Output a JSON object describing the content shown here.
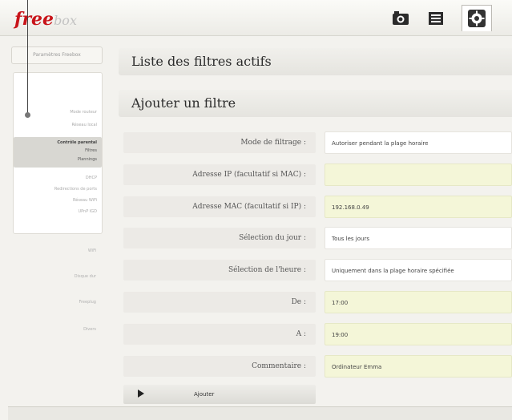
{
  "app": {
    "logo_free": "free",
    "logo_box": "box"
  },
  "topnav": {
    "icons": [
      "camera-icon",
      "film-icon",
      "settings-icon"
    ]
  },
  "sidebar": {
    "top_label": "Paramètres Freebox",
    "items_before": [
      "Mode routeur",
      "Réseau local"
    ],
    "active_group": {
      "title": "Contrôle parental",
      "sub1": "Filtres",
      "sub2": "Plannings"
    },
    "items_after": [
      "DHCP",
      "Redirections de ports",
      "Réseau WiFi",
      "UPnP IGD"
    ],
    "lower": [
      "WiFi",
      "Disque dur",
      "Freeplug",
      "Divers"
    ]
  },
  "main": {
    "list_title": "Liste des filtres actifs",
    "add_title": "Ajouter un filtre",
    "form": [
      {
        "label": "Mode de filtrage :",
        "value": "Autoriser pendant la plage horaire",
        "highlight": false
      },
      {
        "label": "Adresse IP (facultatif si MAC) :",
        "value": "",
        "highlight": true
      },
      {
        "label": "Adresse MAC (facultatif si IP) :",
        "value": "192.168.0.49",
        "highlight": true
      },
      {
        "label": "Sélection du jour :",
        "value": "Tous les jours",
        "highlight": false
      },
      {
        "label": "Sélection de l'heure :",
        "value": "Uniquement dans la plage horaire spécifiée",
        "highlight": false
      },
      {
        "label": "De :",
        "value": "17:00",
        "highlight": true
      },
      {
        "label": "A :",
        "value": "19:00",
        "highlight": true
      },
      {
        "label": "Commentaire :",
        "value": "Ordinateur Emma",
        "highlight": true
      }
    ],
    "add_button": "Ajouter"
  },
  "colors": {
    "brand_red": "#c8141a",
    "highlight_field": "#f4f6d8"
  }
}
